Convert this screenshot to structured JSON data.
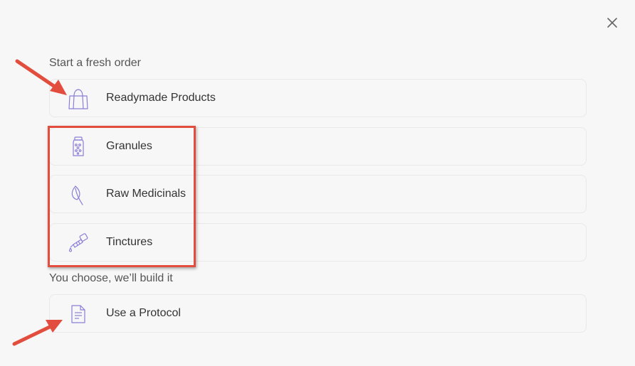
{
  "dialog": {
    "close_icon": "close-icon"
  },
  "sections": {
    "fresh_order": {
      "heading": "Start a fresh order",
      "options": [
        {
          "label": "Readymade Products",
          "icon": "shopping-bag-icon"
        },
        {
          "label": "Granules",
          "icon": "jar-icon"
        },
        {
          "label": "Raw Medicinals",
          "icon": "leaf-icon"
        },
        {
          "label": "Tinctures",
          "icon": "dropper-icon"
        }
      ]
    },
    "build": {
      "heading": "You choose, we’ll build it",
      "options": [
        {
          "label": "Use a Protocol",
          "icon": "document-icon"
        }
      ]
    }
  },
  "annotations": {
    "highlight_color": "#e24d3e",
    "accent_color": "#8a7fd6"
  }
}
